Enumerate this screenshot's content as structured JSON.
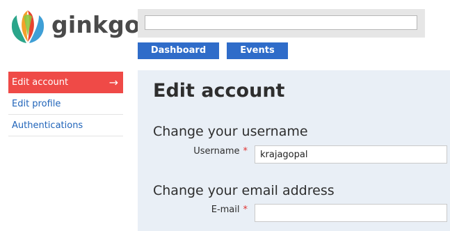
{
  "brand": {
    "name": "ginkgo",
    "logo_icon": "ginkgo-leaf-logo"
  },
  "search": {
    "value": "",
    "placeholder": ""
  },
  "nav": [
    {
      "label": "Dashboard"
    },
    {
      "label": "Events"
    }
  ],
  "sidebar": {
    "items": [
      {
        "label": "Edit account",
        "active": true,
        "icon": "arrow-right-icon",
        "icon_glyph": "→"
      },
      {
        "label": "Edit profile",
        "active": false
      },
      {
        "label": "Authentications",
        "active": false
      }
    ]
  },
  "main": {
    "title": "Edit account",
    "sections": [
      {
        "title": "Change your username",
        "field": {
          "label": "Username",
          "required_marker": "*",
          "value": "krajagopal"
        }
      },
      {
        "title": "Change your email address",
        "field": {
          "label": "E-mail",
          "required_marker": "*",
          "value": ""
        }
      }
    ]
  },
  "colors": {
    "accent_red": "#ef4a47",
    "nav_blue": "#2f6cc9",
    "link_blue": "#1f63b9",
    "panel_bg": "#e9eff6"
  }
}
